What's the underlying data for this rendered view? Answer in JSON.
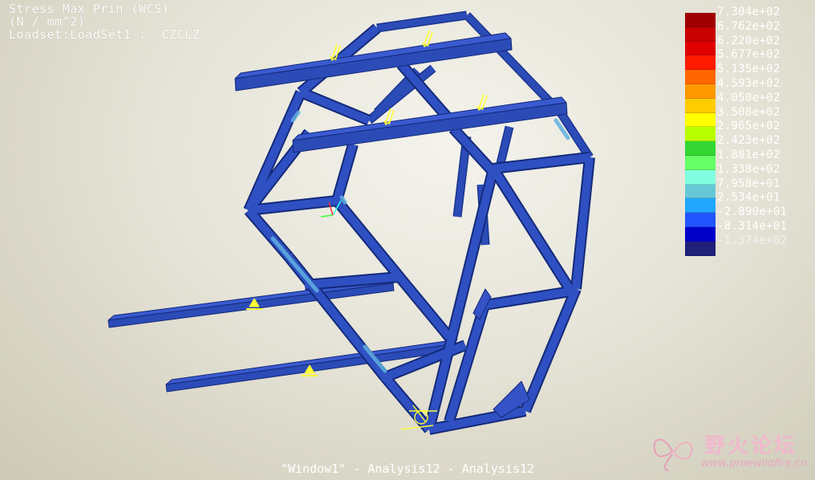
{
  "header": {
    "line1": "Stress Max Prin (WCS)",
    "line2": "(N / mm^2)",
    "line3": "Loadset:LoadSet1 :  CZCLZ"
  },
  "legend": {
    "labels": [
      "7.304e+02",
      "6.762e+02",
      "6.220e+02",
      "5.677e+02",
      "5.135e+02",
      "4.593e+02",
      "4.050e+02",
      "3.508e+02",
      "2.965e+02",
      "2.423e+02",
      "1.881e+02",
      "1.338e+02",
      "7.958e+01",
      "2.534e+01",
      "-2.890e+01",
      "-8.314e+01",
      "-1.374e+02"
    ],
    "colors": [
      "#a00000",
      "#c80000",
      "#e00000",
      "#ff1a00",
      "#ff6600",
      "#ff9900",
      "#ffcc00",
      "#ffff00",
      "#b8ff00",
      "#33d633",
      "#66ff66",
      "#80ffe0",
      "#66c8d6",
      "#22a6ff",
      "#2255ff",
      "#0000c8",
      "#20207a"
    ]
  },
  "footer": {
    "text": "\"Window1\" - Analysis12 - Analysis12"
  },
  "watermark": {
    "title": "野火论坛",
    "url": "www.proewildfire.cn"
  },
  "model": {
    "beam_color": "#2b4bb7",
    "beam_edge": "#142a7a",
    "hotspot_color": "#5fb0e0"
  }
}
